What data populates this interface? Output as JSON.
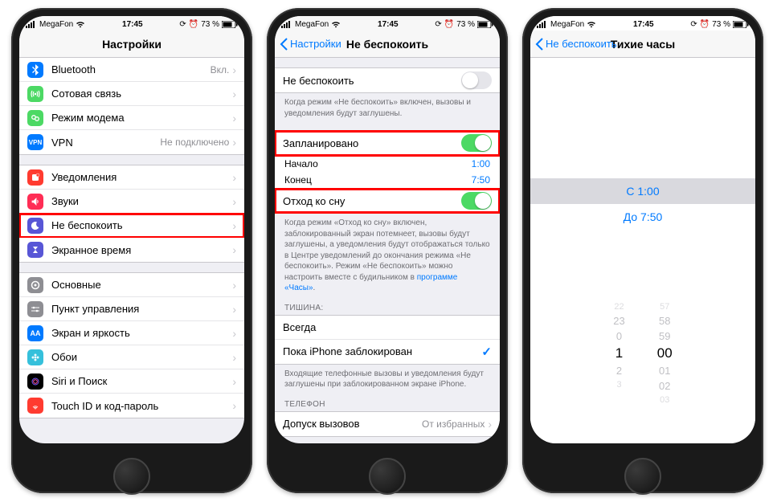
{
  "status": {
    "carrier": "MegaFon",
    "time": "17:45",
    "battery": "73 %"
  },
  "s1": {
    "title": "Настройки",
    "rows": {
      "bluetooth": "Bluetooth",
      "bluetooth_val": "Вкл.",
      "cellular": "Сотовая связь",
      "hotspot": "Режим модема",
      "vpn": "VPN",
      "vpn_val": "Не подключено",
      "notifications": "Уведомления",
      "sounds": "Звуки",
      "dnd": "Не беспокоить",
      "screentime": "Экранное время",
      "general": "Основные",
      "control": "Пункт управления",
      "display": "Экран и яркость",
      "wallpaper": "Обои",
      "siri": "Siri и Поиск",
      "touchid": "Touch ID и код-пароль"
    }
  },
  "s2": {
    "back": "Настройки",
    "title": "Не беспокоить",
    "dnd": "Не беспокоить",
    "dnd_foot": "Когда режим «Не беспокоить» включен, вызовы и уведомления будут заглушены.",
    "scheduled": "Запланировано",
    "from": "Начало",
    "from_v": "1:00",
    "to": "Конец",
    "to_v": "7:50",
    "bedtime": "Отход ко сну",
    "bedtime_foot_a": "Когда режим «Отход ко сну» включен, заблокированный экран потемнеет, вызовы будут заглушены, а уведомления будут отображаться только в Центре уведомлений до окончания режима «Не беспокоить». Режим «Не беспокоить» можно настроить вместе с будильником в ",
    "bedtime_foot_link": "программе «Часы»",
    "silence_hdr": "ТИШИНА:",
    "always": "Всегда",
    "locked": "Пока iPhone заблокирован",
    "silence_foot": "Входящие телефонные вызовы и уведомления будут заглушены при заблокированном экране iPhone.",
    "phone_hdr": "ТЕЛЕФОН",
    "allow": "Допуск вызовов",
    "allow_v": "От избранных"
  },
  "s3": {
    "back": "Не беспокоить",
    "title": "Тихие часы",
    "from": "С 1:00",
    "to": "До 7:50",
    "picker": {
      "h": [
        "22",
        "23",
        "0",
        "1",
        "2",
        "3"
      ],
      "m": [
        "57",
        "58",
        "59",
        "00",
        "01",
        "02",
        "03"
      ]
    }
  }
}
